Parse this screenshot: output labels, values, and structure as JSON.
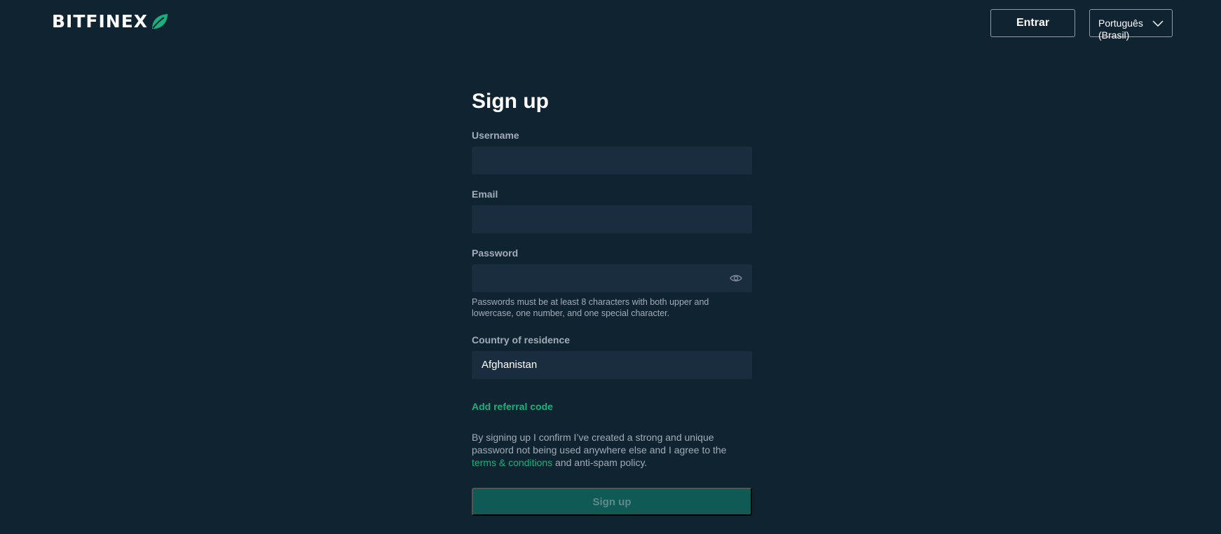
{
  "header": {
    "logo_text": "BITFINEX",
    "login_label": "Entrar",
    "language_label": "Português (Brasil)"
  },
  "form": {
    "title": "Sign up",
    "username_label": "Username",
    "username_value": "",
    "email_label": "Email",
    "email_value": "",
    "password_label": "Password",
    "password_value": "",
    "password_hint": "Passwords must be at least 8 characters with both upper and lowercase, one number, and one special character.",
    "country_label": "Country of residence",
    "country_value": "Afghanistan",
    "referral_label": "Add referral code",
    "consent_before": "By signing up I confirm I’ve created a strong and unique password not being used anywhere else and I agree to the ",
    "consent_link": "terms & conditions",
    "consent_after": " and anti-spam policy.",
    "submit_label": "Sign up"
  },
  "colors": {
    "background": "#102331",
    "field_bg": "#1a2d3f",
    "accent": "#16b17d",
    "submit_bg": "#0f5a54"
  },
  "icons": {
    "logo": "leaf-icon",
    "language_dropdown": "chevron-down-icon",
    "password_toggle": "eye-icon"
  }
}
